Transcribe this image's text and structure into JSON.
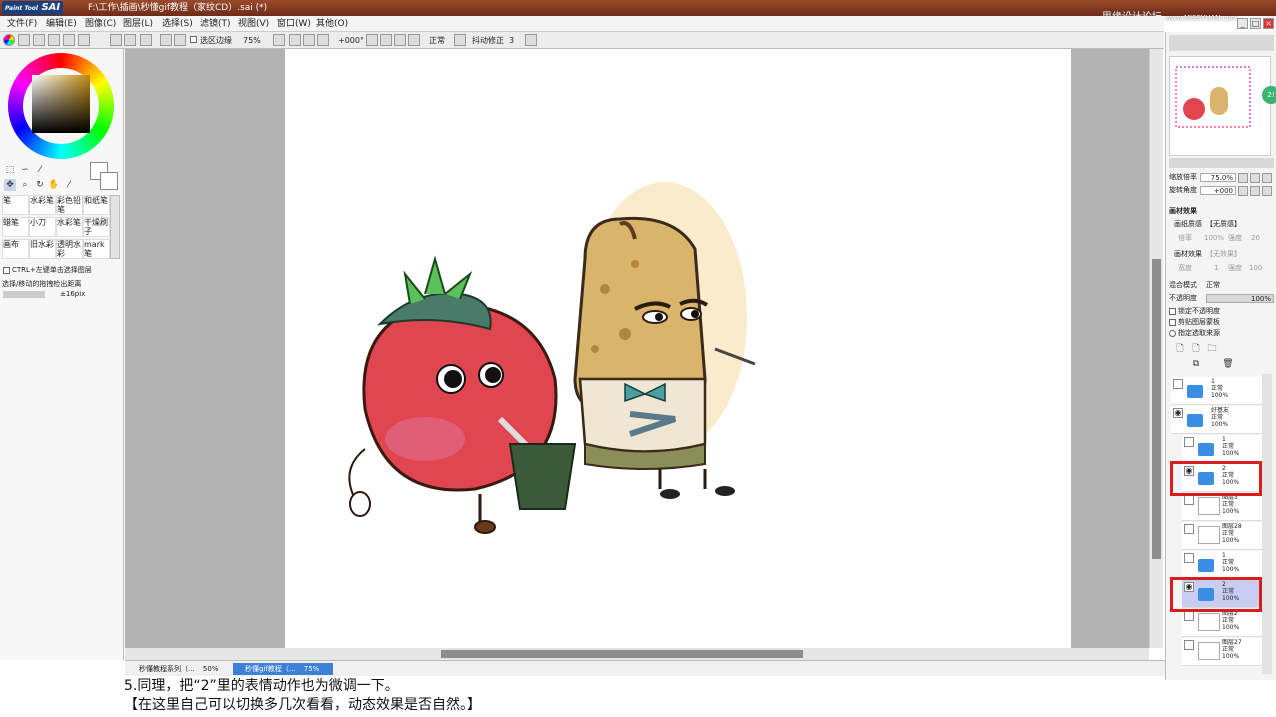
{
  "titlebar": {
    "logo_small": "Paint Tool",
    "logo_big": "SAI",
    "title": "F:\\工作\\插画\\秒懂gif教程（家纹CD）.sai (*)",
    "watermark": "思缘设计论坛",
    "watermark_url": "www.MISSYUAN.com"
  },
  "menubar": {
    "items": [
      "文件(F)",
      "编辑(E)",
      "图像(C)",
      "图层(L)",
      "选择(S)",
      "滤镜(T)",
      "视图(V)",
      "窗口(W)",
      "其他(O)"
    ]
  },
  "toolbar": {
    "selection_edge_label": "选区边缘",
    "zoom": "75%",
    "rotation": "+000°",
    "blend_mode": "正常",
    "stabilizer_label": "抖动修正",
    "stabilizer_value": "3"
  },
  "left_panel": {
    "brushes": [
      [
        "笔",
        "水彩笔",
        "彩色铅笔",
        "和纸笔"
      ],
      [
        "蜡笔",
        "小刀",
        "水彩笔",
        "干燥刷子"
      ],
      [
        "画布",
        "旧水彩",
        "透明水彩",
        "mark笔"
      ]
    ],
    "ctrl_label": "CTRL+左键单击选择图层",
    "drag_label": "选择/移动的拖拽检出距离",
    "drag_value": "±16pix"
  },
  "tabs": [
    {
      "label": "秒懂教程系列（...",
      "zoom": "50%"
    },
    {
      "label": "秒懂gif教程（...",
      "zoom": "75%"
    }
  ],
  "right_panel": {
    "zoom_label": "缩放倍率",
    "zoom_value": "75.0%",
    "rotate_label": "旋转角度",
    "rotate_value": "+000",
    "texture_header": "画材效果",
    "paper_label": "画纸质感",
    "paper_value": "【无质感】",
    "scale_label": "倍率",
    "scale_value": "100%",
    "strength_label": "强度",
    "strength_value": "20",
    "effect_label": "画材效果",
    "effect_value": "【无效果】",
    "width_label": "宽度",
    "width_value": "1",
    "strength2_label": "强度",
    "strength2_value": "100",
    "blend_label": "混合模式",
    "blend_value": "正常",
    "opacity_label": "不透明度",
    "opacity_value": "100%",
    "checks": [
      "锁定不透明度",
      "剪贴图层蒙板",
      "指定选取来源"
    ],
    "badge": "2!",
    "layers": [
      {
        "name": "1",
        "mode": "正常",
        "opacity": "100%",
        "type": "folder"
      },
      {
        "name": "好基友",
        "mode": "正常",
        "opacity": "100%",
        "type": "folder"
      },
      {
        "name": "1",
        "mode": "正常",
        "opacity": "100%",
        "type": "folder"
      },
      {
        "name": "2",
        "mode": "正常",
        "opacity": "100%",
        "type": "folder"
      },
      {
        "name": "图层3",
        "mode": "正常",
        "opacity": "100%",
        "type": "layer"
      },
      {
        "name": "图层28",
        "mode": "正常",
        "opacity": "100%",
        "type": "layer"
      },
      {
        "name": "1",
        "mode": "正常",
        "opacity": "100%",
        "type": "folder"
      },
      {
        "name": "2",
        "mode": "正常",
        "opacity": "100%",
        "type": "folder"
      },
      {
        "name": "图层2",
        "mode": "正常",
        "opacity": "100%",
        "type": "layer"
      },
      {
        "name": "图层27",
        "mode": "正常",
        "opacity": "100%",
        "type": "layer"
      }
    ]
  },
  "caption": {
    "line1": "5.同理，把“2”里的表情动作也为微调一下。",
    "line2": "【在这里自己可以切换多几次看看，动态效果是否自然。】"
  },
  "colors": {
    "titlebar": "#7a3220",
    "highlight": "#d91c1c",
    "selected_layer": "#c9cdf2",
    "folder": "#3a8ee6"
  }
}
